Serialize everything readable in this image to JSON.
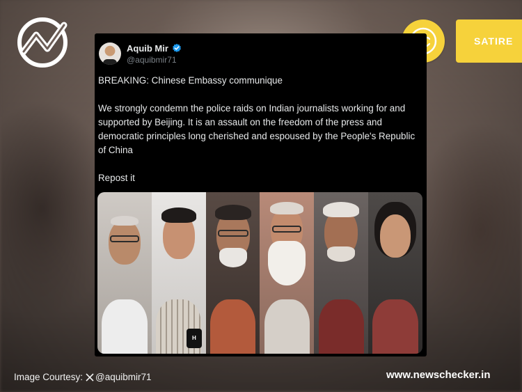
{
  "brand": {
    "site_url": "www.newschecker.in",
    "courtesy_prefix": "Image Courtesy:",
    "courtesy_handle": "@aquibmir71"
  },
  "label": {
    "verdict": "SATIRE",
    "verdict_color": "#f6d23b",
    "emoji_icon": "smiling-face-icon"
  },
  "tweet": {
    "author_name": "Aquib Mir",
    "author_handle": "@aquibmir71",
    "verified_icon": "verified-badge-icon",
    "lines": [
      "BREAKING: Chinese Embassy communique",
      "We strongly condemn the police raids on Indian journalists working for and supported by Beijing. It is an assault on the freedom of the press and democratic principles long cherished and espoused by the People's Republic of China",
      "Repost it"
    ]
  },
  "media": {
    "mic_label": "H"
  }
}
